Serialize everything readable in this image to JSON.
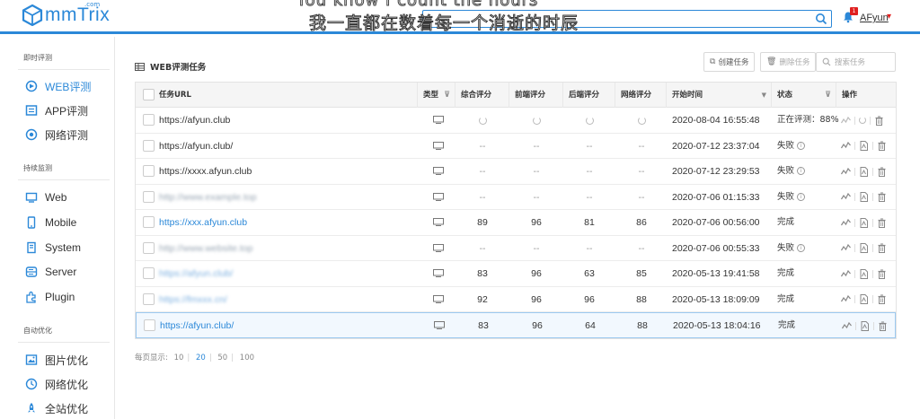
{
  "header": {
    "logo_text": "mmTrix",
    "logo_com": ".com",
    "overlay_line1": "You know I count the hours",
    "overlay_line2": "我一直都在数着每一个消逝的时辰",
    "notification_count": "1",
    "user_name": "AFyun",
    "colors": {
      "brand": "#2b88d8",
      "badge": "#e02020"
    }
  },
  "sidebar": {
    "sections": [
      {
        "title": "即时评测",
        "items": [
          {
            "label": "WEB评测",
            "icon": "web-eval-icon",
            "active": true
          },
          {
            "label": "APP评测",
            "icon": "app-eval-icon"
          },
          {
            "label": "网络评测",
            "icon": "network-eval-icon"
          }
        ]
      },
      {
        "title": "持续监测",
        "items": [
          {
            "label": "Web",
            "icon": "monitor-icon"
          },
          {
            "label": "Mobile",
            "icon": "mobile-icon"
          },
          {
            "label": "System",
            "icon": "system-icon"
          },
          {
            "label": "Server",
            "icon": "server-icon"
          },
          {
            "label": "Plugin",
            "icon": "plugin-icon"
          }
        ]
      },
      {
        "title": "自动优化",
        "items": [
          {
            "label": "图片优化",
            "icon": "image-icon"
          },
          {
            "label": "网络优化",
            "icon": "clock-icon"
          },
          {
            "label": "全站优化",
            "icon": "rocket-icon"
          }
        ]
      }
    ]
  },
  "main": {
    "title": "WEB评测任务",
    "create_label": "创建任务",
    "delete_label": "删除任务",
    "search_placeholder": "搜索任务",
    "columns": {
      "url": "任务URL",
      "type": "类型",
      "overall": "综合评分",
      "frontend": "前端评分",
      "backend": "后端评分",
      "network": "网络评分",
      "start": "开始时间",
      "status": "状态",
      "ops": "操作"
    },
    "rows": [
      {
        "url": "https://afyun.club",
        "style": "plain",
        "overall": "",
        "frontend": "",
        "backend": "",
        "network": "",
        "pending": true,
        "start": "2020-08-04 16:55:48",
        "status": "正在评测：88%",
        "info": false
      },
      {
        "url": "https://afyun.club/",
        "style": "plain",
        "overall": "--",
        "frontend": "--",
        "backend": "--",
        "network": "--",
        "start": "2020-07-12 23:37:04",
        "status": "失败",
        "info": true
      },
      {
        "url": "https://xxxx.afyun.club",
        "style": "plain",
        "overall": "--",
        "frontend": "--",
        "backend": "--",
        "network": "--",
        "start": "2020-07-12 23:29:53",
        "status": "失败",
        "info": true
      },
      {
        "url": "http://www.example.top",
        "style": "blur",
        "overall": "--",
        "frontend": "--",
        "backend": "--",
        "network": "--",
        "start": "2020-07-06 01:15:33",
        "status": "失败",
        "info": true
      },
      {
        "url": "https://xxx.afyun.club",
        "style": "link",
        "overall": "89",
        "frontend": "96",
        "backend": "81",
        "network": "86",
        "start": "2020-07-06 00:56:00",
        "status": "完成",
        "info": false
      },
      {
        "url": "http://www.website.top",
        "style": "blur",
        "overall": "--",
        "frontend": "--",
        "backend": "--",
        "network": "--",
        "start": "2020-07-06 00:55:33",
        "status": "失败",
        "info": true
      },
      {
        "url": "https://afyun.club/",
        "style": "blurlink",
        "overall": "83",
        "frontend": "96",
        "backend": "63",
        "network": "85",
        "start": "2020-05-13 19:41:58",
        "status": "完成",
        "info": false
      },
      {
        "url": "https://fmxxx.cn/",
        "style": "blurlink",
        "overall": "92",
        "frontend": "96",
        "backend": "96",
        "network": "88",
        "start": "2020-05-13 18:09:09",
        "status": "完成",
        "info": false
      },
      {
        "url": "https://afyun.club/",
        "style": "link",
        "overall": "83",
        "frontend": "96",
        "backend": "64",
        "network": "88",
        "start": "2020-05-13 18:04:16",
        "status": "完成",
        "info": false,
        "highlight": true
      }
    ]
  },
  "pager": {
    "label": "每页显示:",
    "options": [
      "10",
      "20",
      "50",
      "100"
    ],
    "active": "20"
  }
}
